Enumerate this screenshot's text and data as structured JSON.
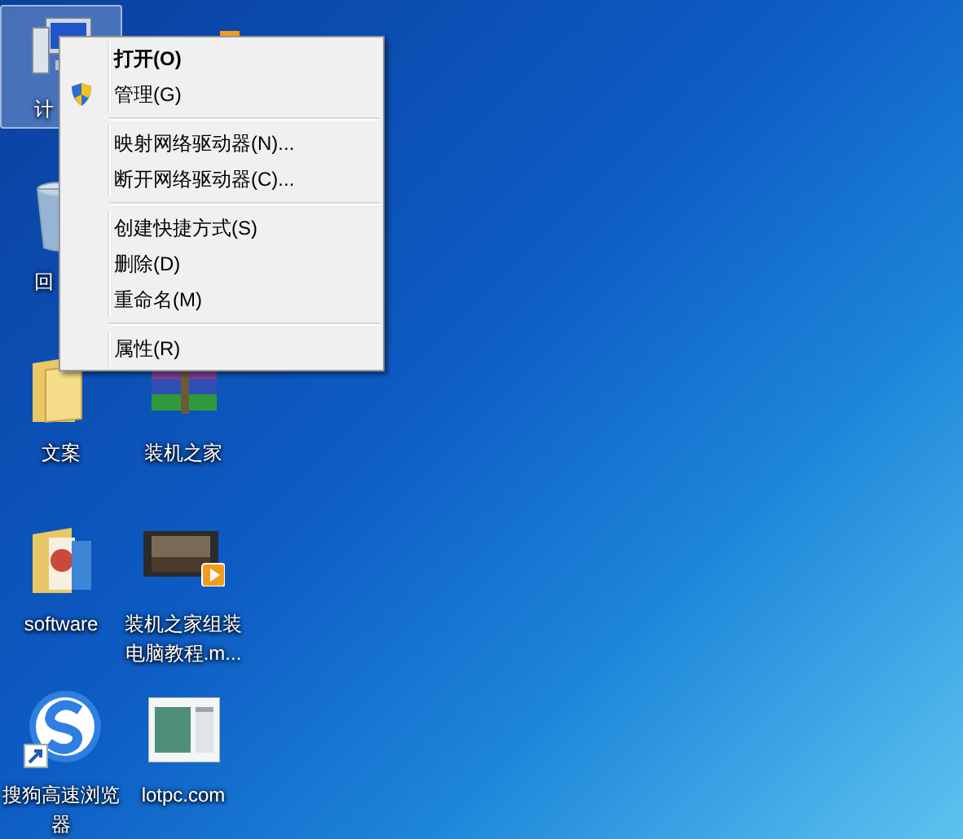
{
  "desktop": {
    "icons": [
      {
        "kind": "computer",
        "label": "计",
        "selected": true
      },
      {
        "kind": "recycle-bin",
        "label": "回",
        "selected": false
      },
      {
        "kind": "folder",
        "label": "文案",
        "selected": false
      },
      {
        "kind": "picture-folder",
        "label": "software",
        "selected": false
      },
      {
        "kind": "browser",
        "label": "搜狗高速浏览器",
        "selected": false
      },
      {
        "kind": "app",
        "selected": false
      },
      {
        "kind": "archive",
        "label": "装机之家",
        "selected": false
      },
      {
        "kind": "video",
        "label": "装机之家组装电脑教程.m...",
        "selected": false
      },
      {
        "kind": "webpage",
        "label": "lotpc.com",
        "selected": false
      }
    ]
  },
  "context_menu": {
    "items": [
      {
        "kind": "command",
        "label": "打开(O)",
        "default": true
      },
      {
        "kind": "admin-command",
        "label": "管理(G)",
        "default": false
      },
      {
        "kind": "separator"
      },
      {
        "kind": "command",
        "label": "映射网络驱动器(N)...",
        "default": false
      },
      {
        "kind": "command",
        "label": "断开网络驱动器(C)...",
        "default": false
      },
      {
        "kind": "separator"
      },
      {
        "kind": "command",
        "label": "创建快捷方式(S)",
        "default": false
      },
      {
        "kind": "command",
        "label": "删除(D)",
        "default": false
      },
      {
        "kind": "command",
        "label": "重命名(M)",
        "default": false
      },
      {
        "kind": "separator"
      },
      {
        "kind": "command",
        "label": "属性(R)",
        "default": false
      }
    ]
  }
}
